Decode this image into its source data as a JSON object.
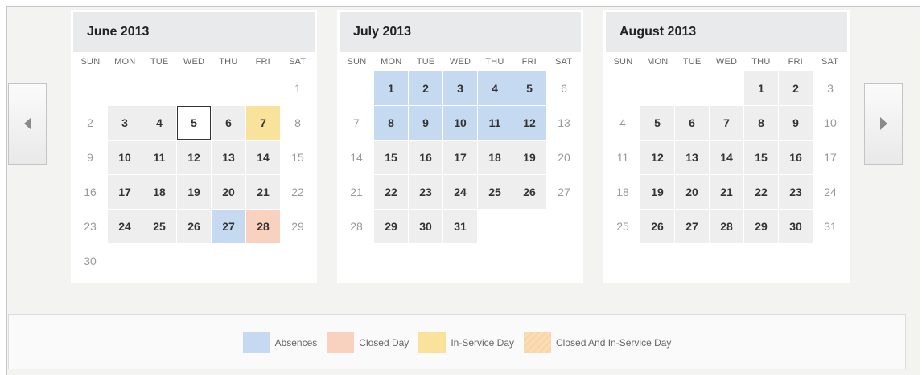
{
  "navigation": {
    "prev_icon": "chevron-left-icon",
    "next_icon": "chevron-right-icon"
  },
  "weekday_headers": [
    "SUN",
    "MON",
    "TUE",
    "WED",
    "THU",
    "FRI",
    "SAT"
  ],
  "months": [
    {
      "title": "June 2013",
      "leading_blanks": 6,
      "days": 30,
      "today": 5,
      "absences": [
        27
      ],
      "closed": [
        28
      ],
      "inservice": [
        7
      ]
    },
    {
      "title": "July 2013",
      "leading_blanks": 1,
      "days": 31,
      "today": null,
      "absences": [
        1,
        2,
        3,
        4,
        5,
        8,
        9,
        10,
        11,
        12
      ],
      "closed": [],
      "inservice": []
    },
    {
      "title": "August 2013",
      "leading_blanks": 4,
      "days": 31,
      "today": null,
      "absences": [],
      "closed": [],
      "inservice": []
    }
  ],
  "legend": [
    {
      "key": "absence",
      "label": "Absences",
      "color": "#c5d9f1"
    },
    {
      "key": "closed",
      "label": "Closed Day",
      "color": "#f9d2bf"
    },
    {
      "key": "inservice",
      "label": "In-Service Day",
      "color": "#f8e29c"
    },
    {
      "key": "both",
      "label": "Closed And In-Service Day",
      "color": "#f8e29c"
    }
  ]
}
